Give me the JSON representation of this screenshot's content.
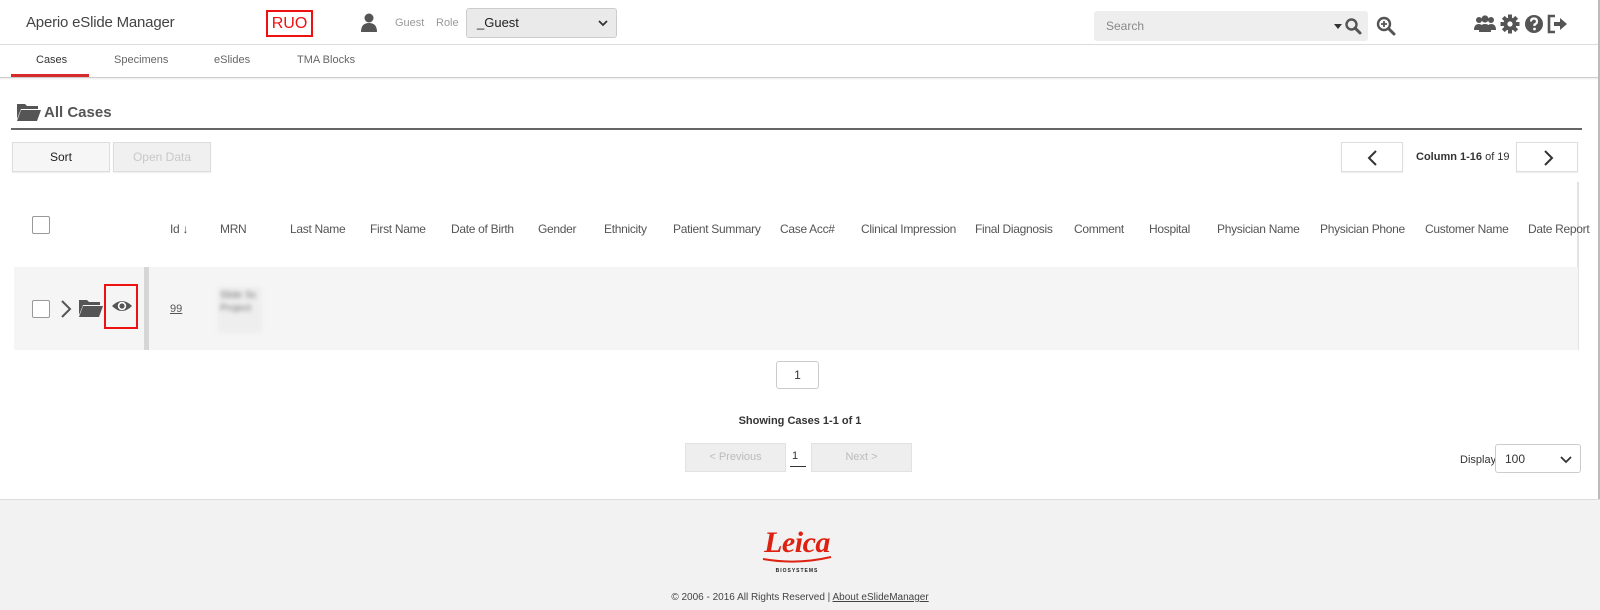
{
  "header": {
    "app_title": "Aperio eSlide Manager",
    "badge": "RUO",
    "user_name": "Guest",
    "role_label": "Role",
    "role_value": "_Guest",
    "search_placeholder": "Search",
    "icons": [
      "user-icon",
      "search-icon",
      "zoom-in-icon",
      "users-icon",
      "gear-icon",
      "help-icon",
      "logout-icon"
    ]
  },
  "tabs": [
    {
      "label": "Cases",
      "active": true
    },
    {
      "label": "Specimens",
      "active": false
    },
    {
      "label": "eSlides",
      "active": false
    },
    {
      "label": "TMA Blocks",
      "active": false
    }
  ],
  "section": {
    "title": "All Cases"
  },
  "toolbar": {
    "sort_label": "Sort",
    "open_data_label": "Open Data",
    "column_range": "Column 1-16",
    "column_total": "of 19"
  },
  "table": {
    "headers": [
      "Id ↓",
      "MRN",
      "Last Name",
      "First Name",
      "Date of Birth",
      "Gender",
      "Ethnicity",
      "Patient Summary",
      "Case Acc#",
      "Clinical Impression",
      "Final Diagnosis",
      "Comment",
      "Hospital",
      "Physician Name",
      "Physician Phone",
      "Customer Name",
      "Date Report"
    ],
    "rows": [
      {
        "id": "99",
        "mrn": "Slide Sc Project"
      }
    ]
  },
  "pagination": {
    "page_box": "1",
    "showing": "Showing Cases 1-1 of 1",
    "previous": "<   Previous",
    "current": "1",
    "next": "Next   >",
    "display_label": "Display",
    "display_value": "100"
  },
  "footer": {
    "logo_text": "Leica",
    "logo_sub": "BIOSYSTEMS",
    "copyright": "© 2006 - 2016 All Rights Reserved |",
    "about_link": "About eSlideManager"
  },
  "colors": {
    "accent": "#d62b2b",
    "ruo": "#ee1111"
  }
}
